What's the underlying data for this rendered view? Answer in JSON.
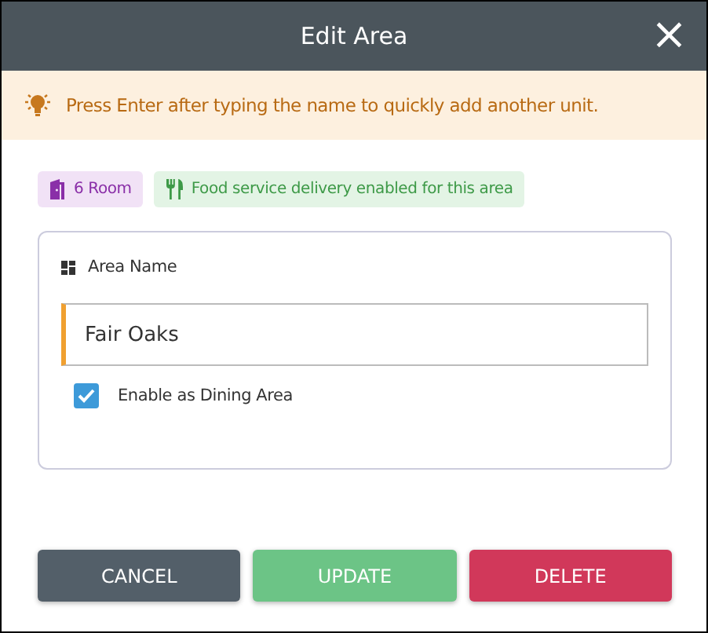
{
  "dialog": {
    "title": "Edit Area",
    "close": "×"
  },
  "tip": {
    "text": "Press Enter after typing the name to quickly add another unit."
  },
  "badges": [
    {
      "kind": "room",
      "label": "6 Room"
    },
    {
      "kind": "food",
      "label": "Food service delivery enabled for this area"
    }
  ],
  "area_name": {
    "label": "Area Name",
    "value": "Fair Oaks"
  },
  "dining": {
    "label": "Enable as Dining Area",
    "checked": true
  },
  "buttons": [
    {
      "kind": "cancel",
      "label": "CANCEL"
    },
    {
      "kind": "update",
      "label": "UPDATE"
    },
    {
      "kind": "delete",
      "label": "DELETE"
    }
  ]
}
